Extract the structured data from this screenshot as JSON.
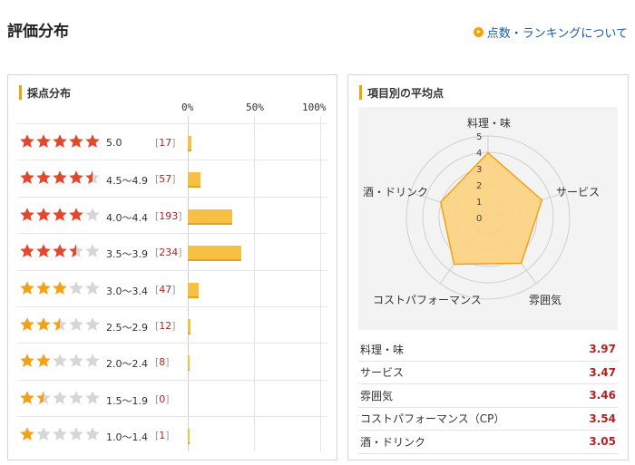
{
  "header": {
    "title": "評価分布",
    "about_link": "点数・ランキングについて"
  },
  "distribution": {
    "title": "採点分布",
    "axis_labels": [
      "0%",
      "50%",
      "100%"
    ],
    "rows": [
      {
        "stars": 5.0,
        "range": "5.0",
        "count": "17"
      },
      {
        "stars": 4.5,
        "range": "4.5～4.9",
        "count": "57"
      },
      {
        "stars": 4.0,
        "range": "4.0～4.4",
        "count": "193"
      },
      {
        "stars": 3.5,
        "range": "3.5～3.9",
        "count": "234"
      },
      {
        "stars": 3.0,
        "range": "3.0～3.4",
        "count": "47"
      },
      {
        "stars": 2.5,
        "range": "2.5～2.9",
        "count": "12"
      },
      {
        "stars": 2.0,
        "range": "2.0～2.4",
        "count": "8"
      },
      {
        "stars": 1.5,
        "range": "1.5～1.9",
        "count": "0"
      },
      {
        "stars": 1.0,
        "range": "1.0～1.4",
        "count": "1"
      }
    ]
  },
  "averages": {
    "title": "項目別の平均点",
    "radar_ticks": [
      "0",
      "1",
      "2",
      "3",
      "4",
      "5"
    ],
    "radar_labels": [
      "料理・味",
      "サービス",
      "雰囲気",
      "コストパフォーマンス",
      "酒・ドリンク"
    ],
    "items": [
      {
        "name": "料理・味",
        "value": "3.97"
      },
      {
        "name": "サービス",
        "value": "3.47"
      },
      {
        "name": "雰囲気",
        "value": "3.46"
      },
      {
        "name": "コストパフォーマンス（CP）",
        "value": "3.54"
      },
      {
        "name": "酒・ドリンク",
        "value": "3.05"
      }
    ]
  },
  "colors": {
    "star_red": "#e0492e",
    "star_orange": "#f0a21a",
    "star_gray": "#d6d6d6",
    "bar_fill": "#f8c042",
    "radar_fill": "#fcd27d",
    "radar_stroke": "#f0a21a",
    "value_red": "#b22222"
  },
  "chart_data": {
    "type": "bar",
    "categories": [
      "5.0",
      "4.5～4.9",
      "4.0～4.4",
      "3.5～3.9",
      "3.0～3.4",
      "2.5～2.9",
      "2.0～2.4",
      "1.5～1.9",
      "1.0～1.4"
    ],
    "values": [
      17,
      57,
      193,
      234,
      47,
      12,
      8,
      0,
      1
    ],
    "xlim": [
      0,
      100
    ],
    "tick_labels": [
      "0%",
      "50%",
      "100%"
    ]
  }
}
